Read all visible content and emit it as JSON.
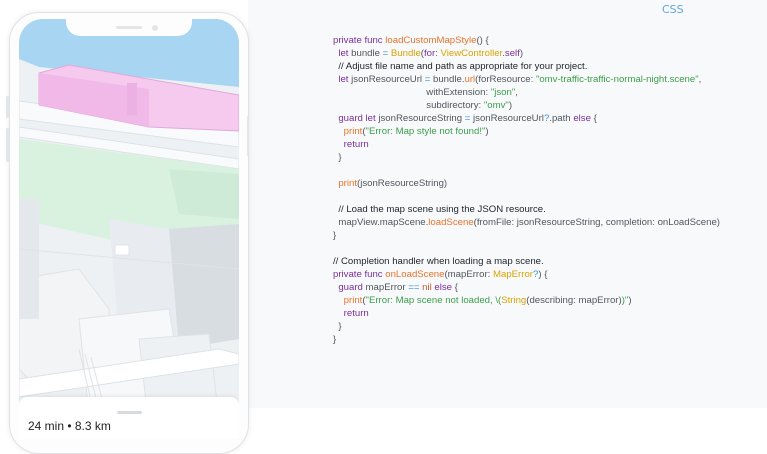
{
  "tab": {
    "label": "CSS"
  },
  "route": {
    "summary": "24 min • 8.3 km"
  },
  "code": {
    "lines": [
      [
        [
          "kw",
          "private func "
        ],
        [
          "fn",
          "loadCustomMapStyle"
        ],
        [
          "",
          "() {"
        ]
      ],
      [
        [
          "",
          "  "
        ],
        [
          "kw",
          "let"
        ],
        [
          "",
          " bundle "
        ],
        [
          "op",
          "="
        ],
        [
          "",
          " "
        ],
        [
          "ty",
          "Bundle"
        ],
        [
          "",
          "("
        ],
        [
          "kw",
          "for"
        ],
        [
          "",
          ": "
        ],
        [
          "ty",
          "ViewController"
        ],
        [
          "",
          "."
        ],
        [
          "kw",
          "self"
        ],
        [
          "",
          ")"
        ]
      ],
      [
        [
          "",
          "  "
        ],
        [
          "cm",
          "// Adjust file name and path as appropriate for your project."
        ]
      ],
      [
        [
          "",
          "  "
        ],
        [
          "kw",
          "let"
        ],
        [
          "",
          " jsonResourceUrl "
        ],
        [
          "op",
          "="
        ],
        [
          "",
          " bundle."
        ],
        [
          "fn",
          "url"
        ],
        [
          "",
          "(forResource: "
        ],
        [
          "str",
          "\"omv-traffic-traffic-normal-night.scene\""
        ],
        [
          "",
          ","
        ]
      ],
      [
        [
          "",
          "                                   withExtension: "
        ],
        [
          "str",
          "\"json\""
        ],
        [
          "",
          ","
        ]
      ],
      [
        [
          "",
          "                                   subdirectory: "
        ],
        [
          "str",
          "\"omv\""
        ],
        [
          "",
          ")"
        ]
      ],
      [
        [
          "",
          "  "
        ],
        [
          "kw",
          "guard let"
        ],
        [
          "",
          " jsonResourceString "
        ],
        [
          "op",
          "="
        ],
        [
          "",
          " jsonResourceUrl"
        ],
        [
          "op",
          "?"
        ],
        [
          "",
          ".path "
        ],
        [
          "kw",
          "else"
        ],
        [
          "",
          " {"
        ]
      ],
      [
        [
          "",
          "    "
        ],
        [
          "fn",
          "print"
        ],
        [
          "",
          "("
        ],
        [
          "str",
          "\"Error: Map style not found!\""
        ],
        [
          "",
          ")"
        ]
      ],
      [
        [
          "",
          "    "
        ],
        [
          "kw",
          "return"
        ]
      ],
      [
        [
          "",
          "  }"
        ]
      ],
      [
        [
          "",
          ""
        ]
      ],
      [
        [
          "",
          "  "
        ],
        [
          "fn",
          "print"
        ],
        [
          "",
          "(jsonResourceString)"
        ]
      ],
      [
        [
          "",
          ""
        ]
      ],
      [
        [
          "",
          "  "
        ],
        [
          "cm",
          "// Load the map scene using the JSON resource."
        ]
      ],
      [
        [
          "",
          "  mapView.mapScene."
        ],
        [
          "fn",
          "loadScene"
        ],
        [
          "",
          "(fromFile: jsonResourceString, completion: onLoadScene)"
        ]
      ],
      [
        [
          "",
          "}"
        ]
      ],
      [
        [
          "",
          ""
        ]
      ],
      [
        [
          "cm",
          "// Completion handler when loading a map scene."
        ]
      ],
      [
        [
          "kw",
          "private func "
        ],
        [
          "fn",
          "onLoadScene"
        ],
        [
          "",
          "(mapError: "
        ],
        [
          "ty",
          "MapError"
        ],
        [
          "op",
          "?"
        ],
        [
          "",
          ") {"
        ]
      ],
      [
        [
          "",
          "  "
        ],
        [
          "kw",
          "guard"
        ],
        [
          "",
          " mapError "
        ],
        [
          "op",
          "=="
        ],
        [
          "",
          " "
        ],
        [
          "lit",
          "nil"
        ],
        [
          "",
          " "
        ],
        [
          "kw",
          "else"
        ],
        [
          "",
          " {"
        ]
      ],
      [
        [
          "",
          "    "
        ],
        [
          "fn",
          "print"
        ],
        [
          "",
          "("
        ],
        [
          "str",
          "\"Error: Map scene not loaded, \\("
        ],
        [
          "ty",
          "String"
        ],
        [
          "",
          "(describing: mapError)"
        ],
        [
          "str",
          ")\""
        ],
        [
          "",
          ")"
        ]
      ],
      [
        [
          "",
          "    "
        ],
        [
          "kw",
          "return"
        ]
      ],
      [
        [
          "",
          "  }"
        ]
      ],
      [
        [
          "",
          "}"
        ]
      ]
    ]
  }
}
